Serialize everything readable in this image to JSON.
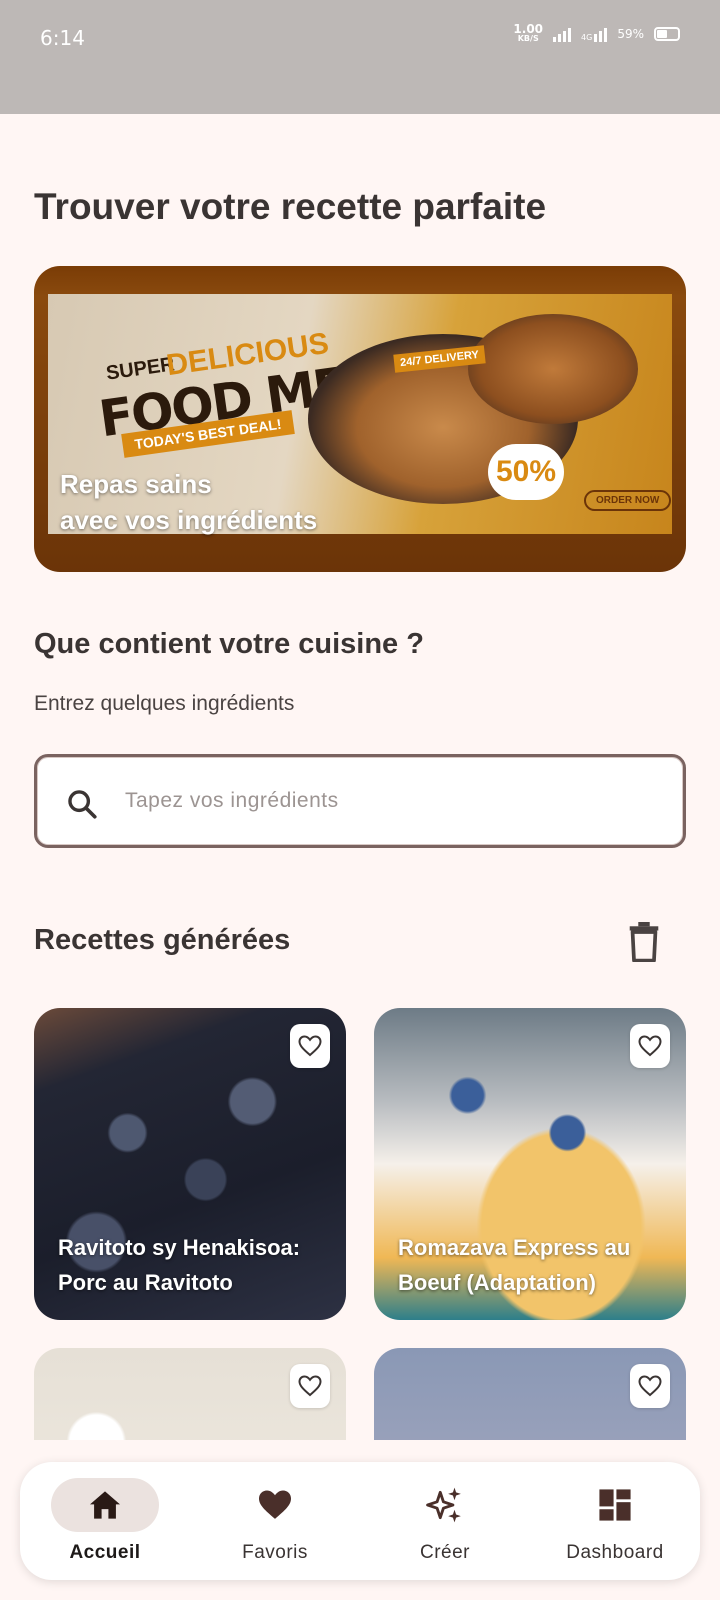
{
  "status_bar": {
    "time": "6:14",
    "net_speed_value": "1.00",
    "net_speed_unit": "KB/S",
    "network_type": "4G",
    "battery_percent": "59%"
  },
  "header": {
    "title": "Trouver votre recette parfaite"
  },
  "banner": {
    "caption_line1": "Repas sains",
    "caption_line2": "avec vos ingrédients",
    "image_text": {
      "super": "SUPER",
      "delicious": "DELICIOUS",
      "food_menu": "FOOD MENU",
      "best_deal": "TODAY'S BEST DEAL!",
      "delivery": "24/7 DELIVERY",
      "sale": "50%",
      "order": "ORDER NOW"
    }
  },
  "kitchen": {
    "title": "Que contient votre cuisine ?",
    "subtitle": "Entrez quelques ingrédients"
  },
  "search": {
    "value": "",
    "placeholder": "Tapez vos ingrédients"
  },
  "generated": {
    "title": "Recettes générées",
    "recipes": [
      {
        "title": "Ravitoto sy Henakisoa: Porc au Ravitoto",
        "favorite": false
      },
      {
        "title": "Romazava Express au Boeuf (Adaptation)",
        "favorite": false
      },
      {
        "title": "",
        "favorite": false
      },
      {
        "title": "",
        "favorite": false
      }
    ]
  },
  "nav": {
    "items": [
      {
        "label": "Accueil",
        "icon": "home-icon",
        "active": true
      },
      {
        "label": "Favoris",
        "icon": "heart-icon",
        "active": false
      },
      {
        "label": "Créer",
        "icon": "sparkles-icon",
        "active": false
      },
      {
        "label": "Dashboard",
        "icon": "dashboard-icon",
        "active": false
      }
    ]
  },
  "colors": {
    "background": "#fff6f4",
    "status_bar": "#bdb8b6",
    "text": "#3a3433",
    "search_border": "#7a6360",
    "nav_active_pill": "#ebe2df"
  }
}
